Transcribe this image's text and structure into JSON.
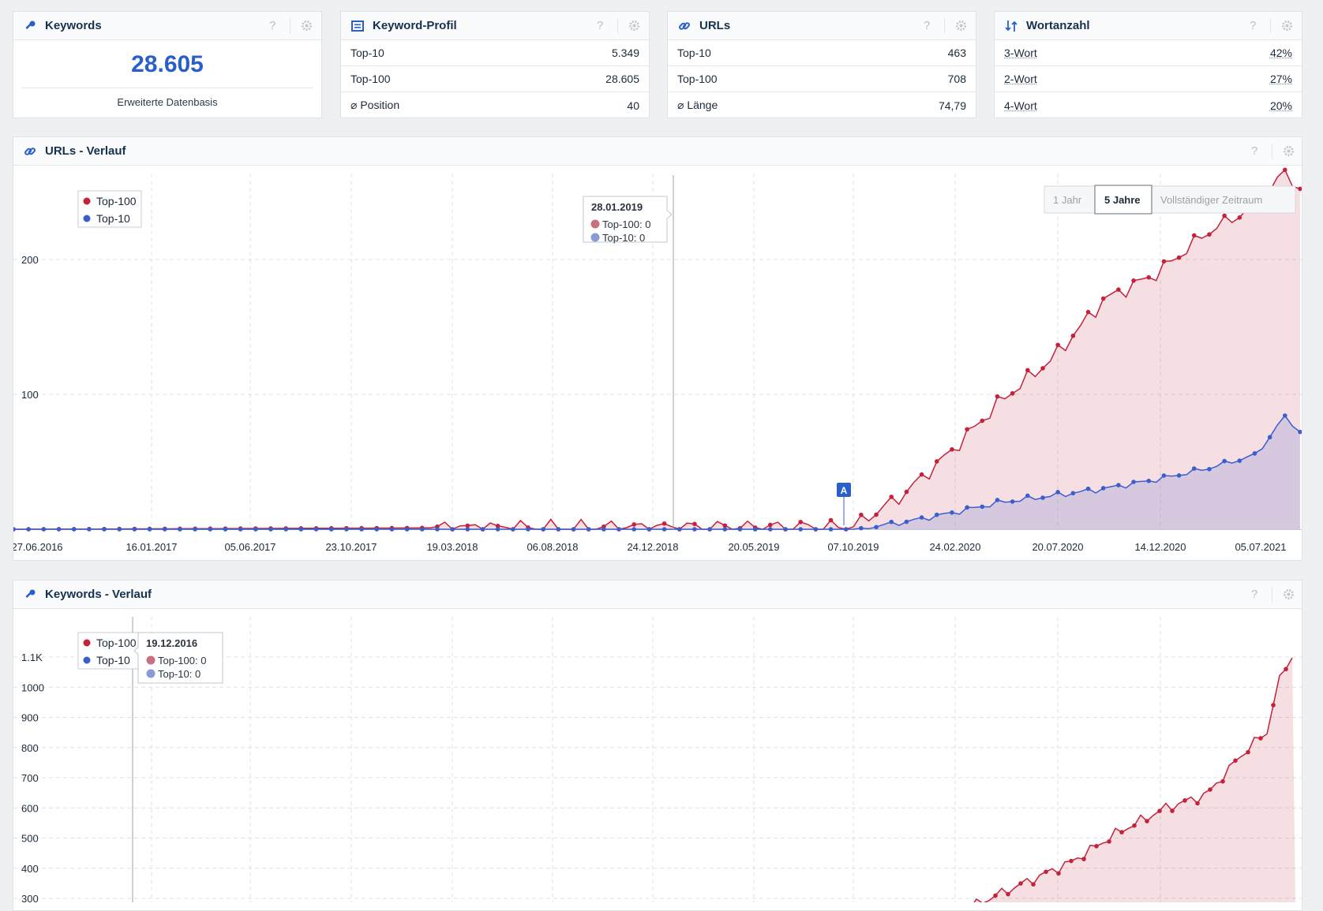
{
  "widgets": {
    "keywords": {
      "title": "Keywords",
      "value": "28.605",
      "subtitle": "Erweiterte Datenbasis"
    },
    "keyword_profile": {
      "title": "Keyword-Profil",
      "rows": [
        {
          "label": "Top-10",
          "value": "5.349"
        },
        {
          "label": "Top-100",
          "value": "28.605"
        },
        {
          "label": "⌀ Position",
          "value": "40"
        }
      ]
    },
    "urls": {
      "title": "URLs",
      "rows": [
        {
          "label": "Top-10",
          "value": "463"
        },
        {
          "label": "Top-100",
          "value": "708"
        },
        {
          "label": "⌀ Länge",
          "value": "74,79"
        }
      ]
    },
    "wortanzahl": {
      "title": "Wortanzahl",
      "rows": [
        {
          "label": "3-Wort",
          "value": "42%"
        },
        {
          "label": "2-Wort",
          "value": "27%"
        },
        {
          "label": "4-Wort",
          "value": "20%"
        }
      ]
    },
    "help_glyph": "?"
  },
  "urls_chart": {
    "title": "URLs - Verlauf",
    "legend": [
      "Top-100",
      "Top-10"
    ],
    "time_buttons": [
      "1 Jahr",
      "5 Jahre",
      "Vollständiger Zeitraum"
    ],
    "active_button": "5 Jahre",
    "tooltip": {
      "date": "28.01.2019",
      "top100": "Top-100: 0",
      "top10": "Top-10: 0"
    },
    "annotation": "A",
    "colors": {
      "top100": "#c5213a",
      "top10": "#3a5fcd"
    }
  },
  "keywords_chart": {
    "title": "Keywords - Verlauf",
    "legend": [
      "Top-100",
      "Top-10"
    ],
    "tooltip": {
      "date": "19.12.2016",
      "top100": "Top-100: 0",
      "top10": "Top-10: 0"
    }
  },
  "chart_data": [
    {
      "type": "area",
      "title": "URLs - Verlauf",
      "x_tick_labels": [
        "27.06.2016",
        "16.01.2017",
        "05.06.2017",
        "23.10.2017",
        "19.03.2018",
        "06.08.2018",
        "24.12.2018",
        "20.05.2019",
        "07.10.2019",
        "24.02.2020",
        "20.07.2020",
        "14.12.2020",
        "05.07.2021"
      ],
      "y_ticks": [
        100,
        200
      ],
      "ylim": [
        0,
        265
      ],
      "x": [
        "2016-06-27",
        "2019-10-07",
        "2019-12-16",
        "2020-02-24",
        "2020-05-04",
        "2020-07-20",
        "2020-09-28",
        "2020-12-14",
        "2021-02-22",
        "2021-05-03",
        "2021-06-14",
        "2021-07-05"
      ],
      "series": [
        {
          "name": "Top-100",
          "values": [
            0,
            2,
            25,
            58,
            95,
            128,
            170,
            190,
            220,
            240,
            265,
            252
          ]
        },
        {
          "name": "Top-10",
          "values": [
            0,
            0,
            5,
            12,
            20,
            25,
            30,
            37,
            45,
            55,
            84,
            72
          ]
        }
      ]
    },
    {
      "type": "area",
      "title": "Keywords - Verlauf",
      "y_ticks": [
        300,
        400,
        500,
        600,
        700,
        800,
        900,
        1000,
        "1.1K"
      ],
      "series": [
        {
          "name": "Top-100",
          "values": [
            0,
            270,
            350,
            420,
            520,
            600,
            650,
            740,
            820,
            840,
            1010,
            1160,
            1040,
            1150
          ]
        },
        {
          "name": "Top-10",
          "values": [
            0
          ]
        }
      ]
    }
  ]
}
